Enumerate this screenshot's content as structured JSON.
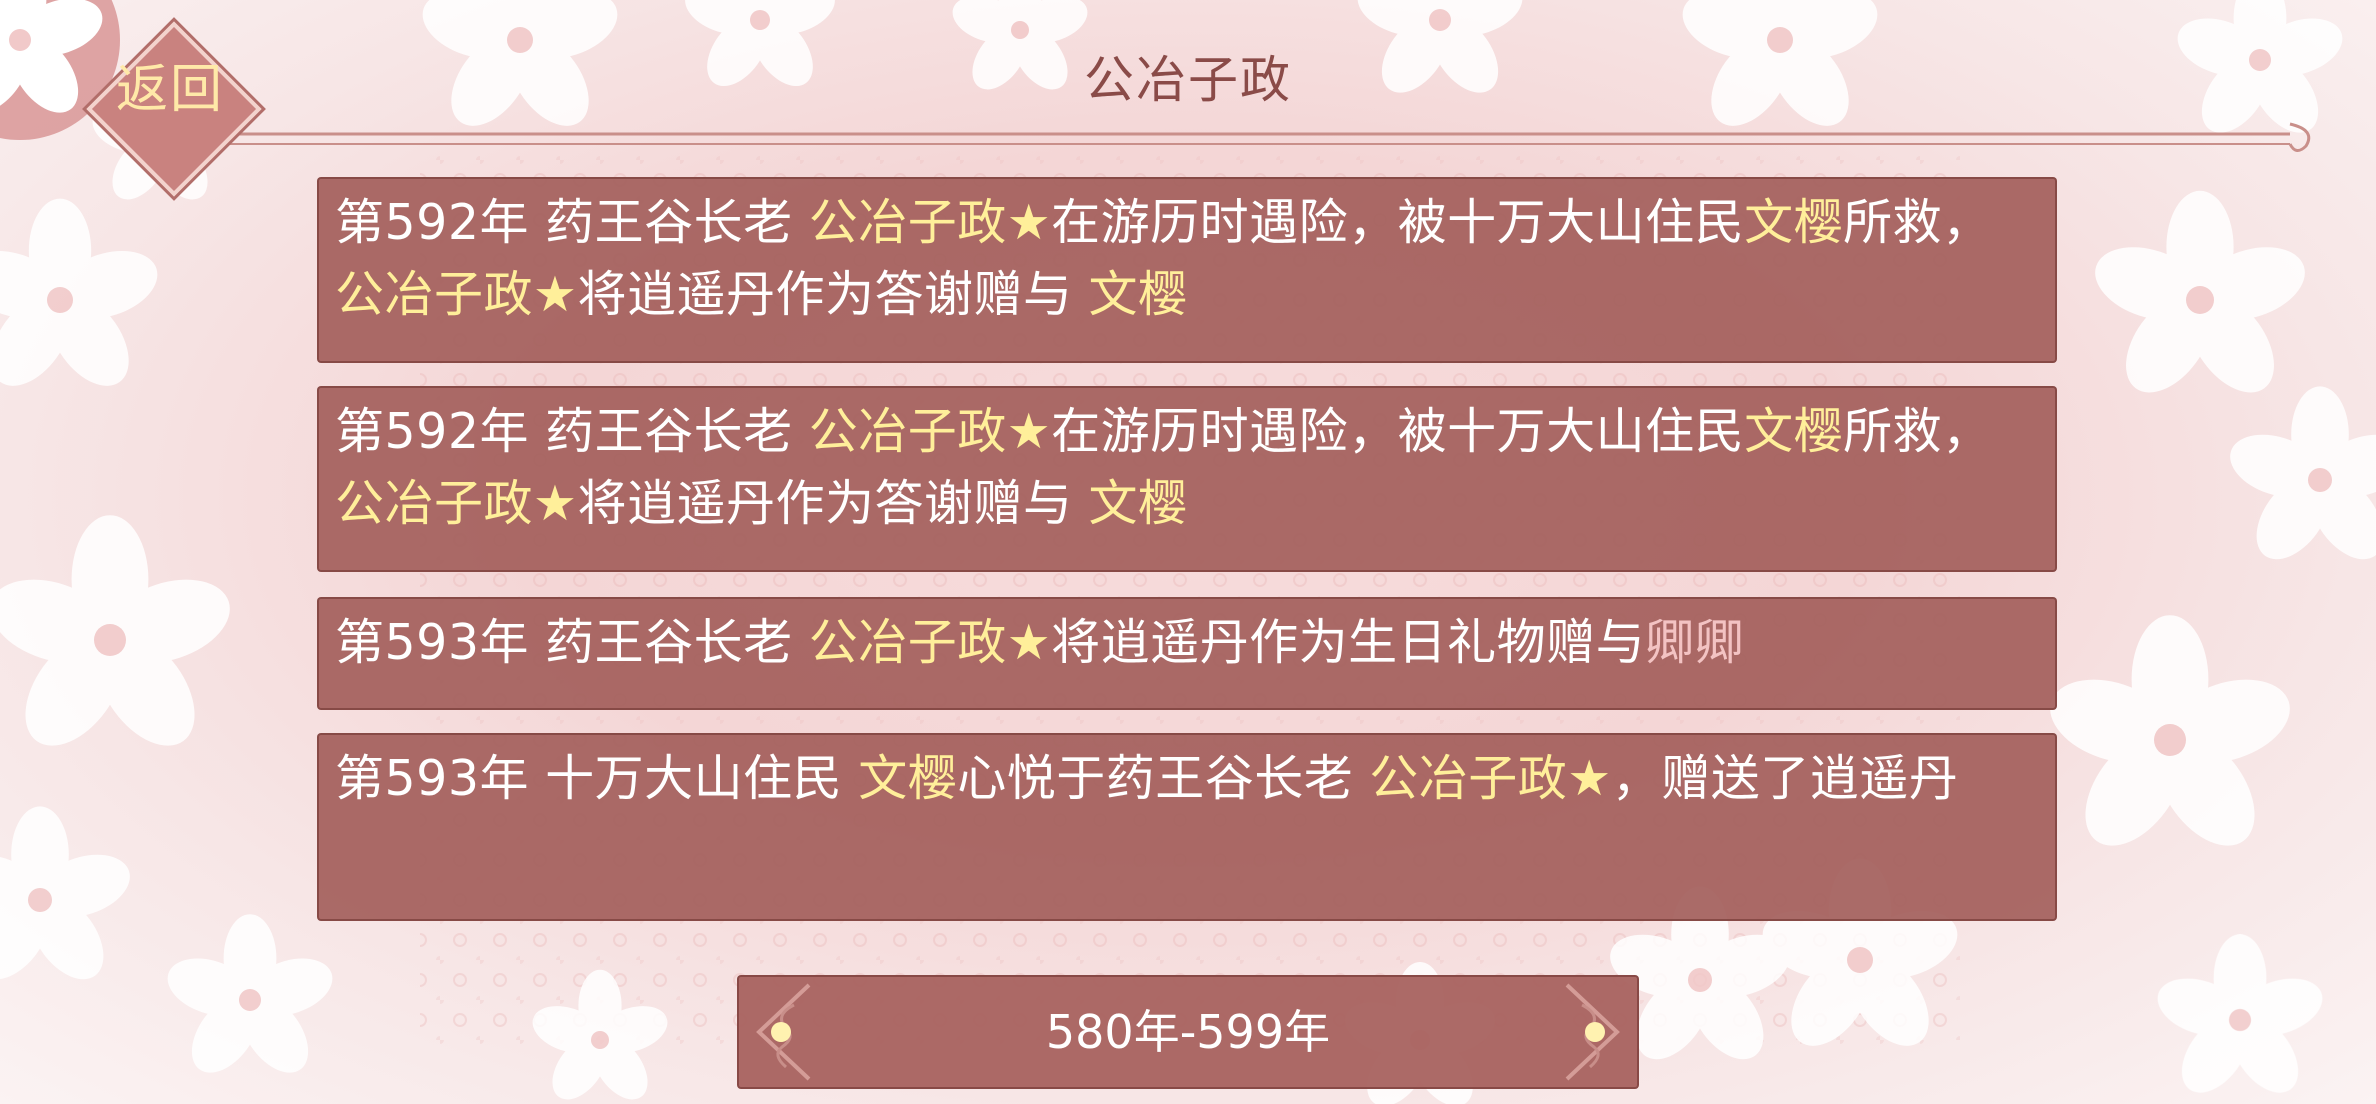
{
  "header": {
    "title": "公冶子政",
    "back_label": "返回"
  },
  "events": [
    {
      "segments": [
        {
          "text": "第592年 药王谷长老 ",
          "hl": ""
        },
        {
          "text": "公冶子政★",
          "hl": "hl"
        },
        {
          "text": "在游历时遇险，被十万大山住民",
          "hl": ""
        },
        {
          "text": "文樱",
          "hl": "hl"
        },
        {
          "text": "所救，",
          "hl": ""
        },
        {
          "text": "公冶子政★",
          "hl": "hl"
        },
        {
          "text": "将逍遥丹作为答谢赠与 ",
          "hl": ""
        },
        {
          "text": "文樱",
          "hl": "hl"
        }
      ]
    },
    {
      "segments": [
        {
          "text": "第592年 药王谷长老 ",
          "hl": ""
        },
        {
          "text": "公冶子政★",
          "hl": "hl"
        },
        {
          "text": "在游历时遇险，被十万大山住民",
          "hl": ""
        },
        {
          "text": "文樱",
          "hl": "hl"
        },
        {
          "text": "所救，",
          "hl": ""
        },
        {
          "text": "公冶子政★",
          "hl": "hl"
        },
        {
          "text": "将逍遥丹作为答谢赠与 ",
          "hl": ""
        },
        {
          "text": "文樱",
          "hl": "hl"
        }
      ]
    },
    {
      "segments": [
        {
          "text": "第593年 药王谷长老 ",
          "hl": ""
        },
        {
          "text": "公冶子政★",
          "hl": "hl"
        },
        {
          "text": "将逍遥丹作为生日礼物赠与",
          "hl": ""
        },
        {
          "text": "卿卿",
          "hl": "hl2"
        }
      ]
    },
    {
      "segments": [
        {
          "text": "第593年 十万大山住民 ",
          "hl": ""
        },
        {
          "text": "文樱",
          "hl": "hl"
        },
        {
          "text": "心悦于药王谷长老 ",
          "hl": ""
        },
        {
          "text": "公冶子政★",
          "hl": "hl"
        },
        {
          "text": "，赠送了逍遥丹",
          "hl": ""
        }
      ]
    }
  ],
  "pagination": {
    "range_label": "580年-599年"
  },
  "colors": {
    "panel": "#a4605d",
    "highlight_name": "#ffef9a",
    "highlight_pink": "#f3c3c3",
    "title": "#8a4b48"
  }
}
